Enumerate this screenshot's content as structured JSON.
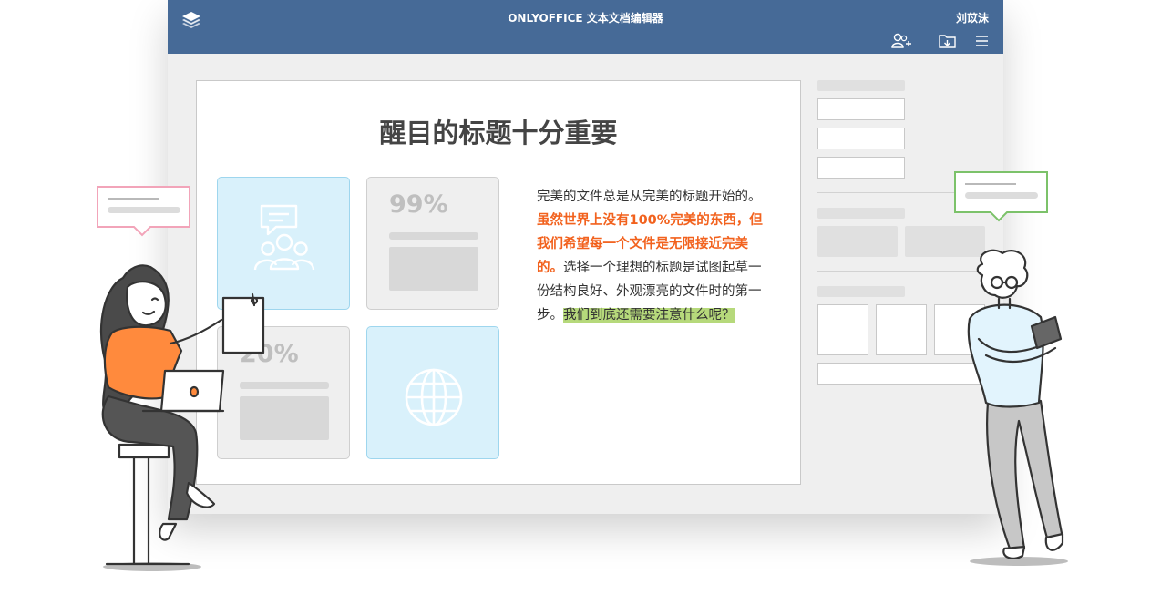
{
  "window": {
    "app_title": "ONLYOFFICE 文本文档编辑器",
    "user_name": "刘苡沫",
    "icons": [
      "layers-logo-icon",
      "add-user-icon",
      "open-folder-icon",
      "menu-icon"
    ],
    "titlebar_color": "#466a97"
  },
  "document": {
    "title": "醒目的标题十分重要",
    "cards": [
      {
        "kind": "people-chat-icon",
        "color": "#d9f1fb"
      },
      {
        "kind": "stat",
        "label": "99%"
      },
      {
        "kind": "stat",
        "label": "20%"
      },
      {
        "kind": "globe-icon",
        "color": "#d9f1fb"
      }
    ],
    "paragraph": {
      "part1": "完美的文件总是从完美的标题开始的。",
      "part2_highlight": "虽然世界上没有100%完美的东西，但我们希望每一个文件是无限接近完美的。",
      "part3": "选择一个理想的标题是试图起草一份结构良好、外观漂亮的文件时的第一步。",
      "part4_highlight": "我们到底还需要注意什么呢？"
    },
    "highlight_colors": {
      "orange": "#f2621e",
      "green": "#b6d97b"
    }
  }
}
